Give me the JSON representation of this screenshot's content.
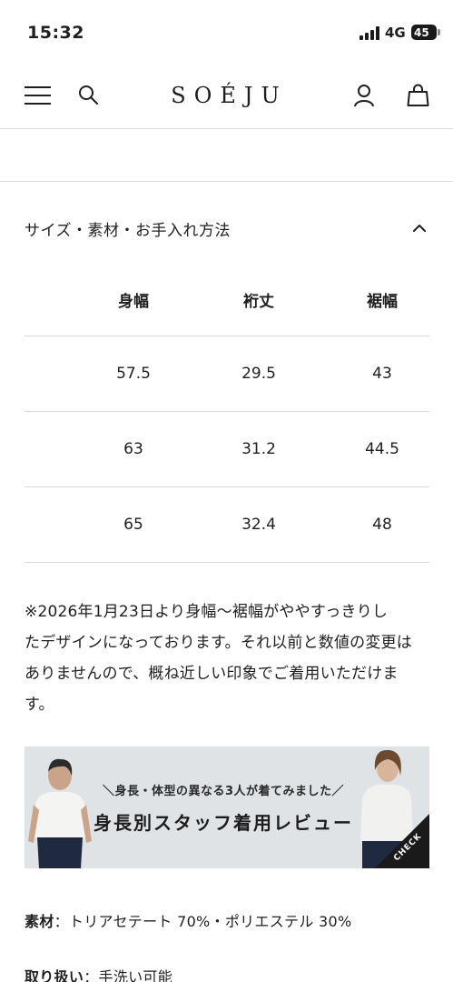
{
  "status_bar": {
    "time": "15:32",
    "network": "4G",
    "battery": "45"
  },
  "header": {
    "brand": "SOÉJU",
    "icons": [
      "menu-icon",
      "search-icon",
      "account-icon",
      "cart-icon"
    ]
  },
  "accordion": {
    "title": "サイズ・素材・お手入れ方法",
    "state": "expanded"
  },
  "size_table": {
    "columns": [
      "身幅",
      "裄丈",
      "裾幅"
    ],
    "rows": [
      [
        "57.5",
        "29.5",
        "43"
      ],
      [
        "63",
        "31.2",
        "44.5"
      ],
      [
        "65",
        "32.4",
        "48"
      ]
    ]
  },
  "note": {
    "lines": [
      "※2026年1月23日より身幅〜裾幅がややすっきりし",
      "たデザインになっております。それ以前と数値の変更は",
      "ありませんので、概ね近しい印象でご着用いただけま",
      "す。"
    ]
  },
  "banner": {
    "subtitle": "＼身長・体型の異なる3人が着てみました／",
    "title": "身長別スタッフ着用レビュー",
    "badge": "CHECK"
  },
  "materials": {
    "material_key": "素材",
    "material_value": "トリアセテート 70%・ポリエステル 30%",
    "care_key": "取り扱い",
    "care_value": "手洗い可能"
  },
  "colors": {
    "text": "#1f1f1f",
    "divider": "#d8d8d8",
    "banner_bg": "#dfe3e6"
  }
}
